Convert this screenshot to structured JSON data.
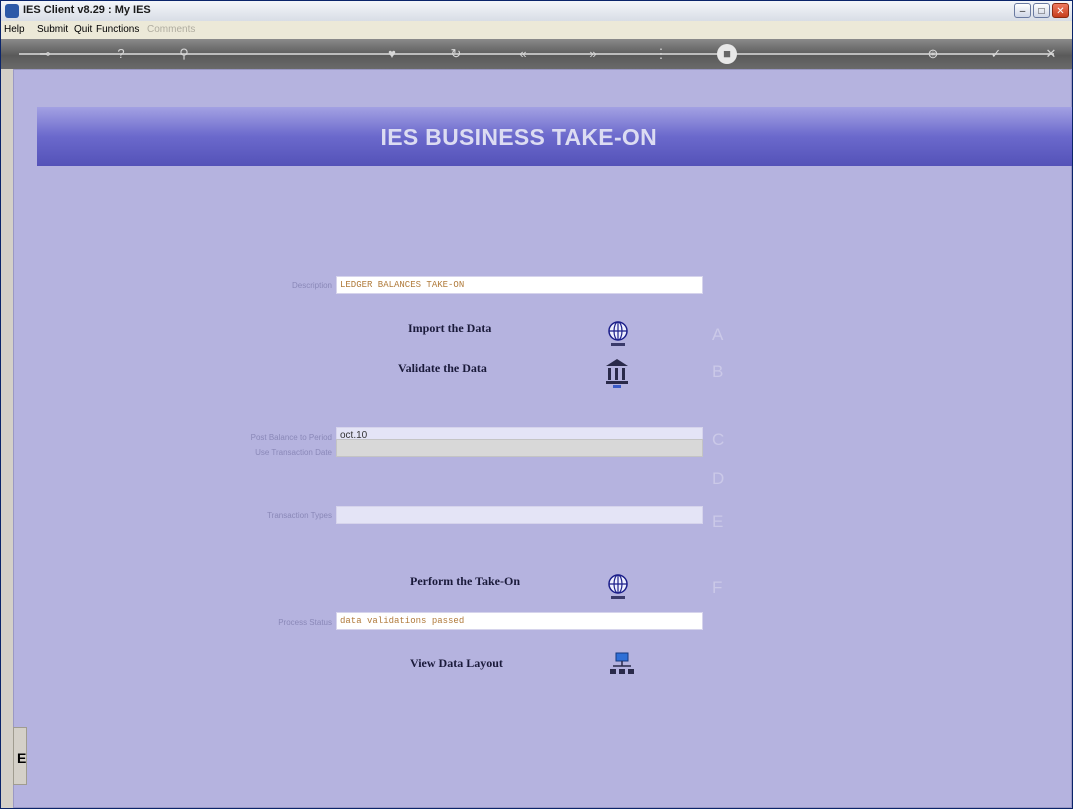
{
  "window": {
    "title": "IES Client v8.29 : My IES"
  },
  "menu": {
    "help": "Help",
    "submit": "Submit",
    "quit": "Quit",
    "functions": "Functions",
    "comments": "Comments"
  },
  "banner": {
    "title": "IES BUSINESS TAKE-ON"
  },
  "form": {
    "description": {
      "label": "Description",
      "value": "LEDGER BALANCES TAKE-ON"
    },
    "import_data": {
      "label": "Import the Data",
      "letter": "A"
    },
    "validate_data": {
      "label": "Validate the Data",
      "letter": "B"
    },
    "post_balance": {
      "label": "Post Balance to Period",
      "value": "oct.10",
      "letter": "C"
    },
    "use_transaction_date": {
      "label": "Use Transaction Date",
      "value": "",
      "letter": "D"
    },
    "transaction_types": {
      "label": "Transaction Types",
      "value": "",
      "letter": "E"
    },
    "perform_takeon": {
      "label": "Perform the Take-On",
      "letter": "F"
    },
    "process_status": {
      "label": "Process Status",
      "value": "data validations passed"
    },
    "view_layout": {
      "label": "View Data Layout"
    }
  },
  "sidebar": {
    "letter": "E"
  }
}
